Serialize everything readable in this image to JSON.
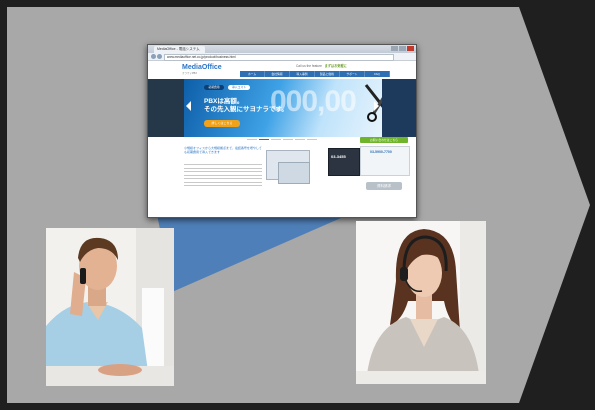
{
  "colors": {
    "background": "#1f1f1f",
    "chevron": "#a8a8a8",
    "funnel": "#4f7fb8",
    "accent_blue": "#2f6fb3",
    "accent_green": "#6fb52c",
    "accent_orange": "#f0a21b"
  },
  "browser": {
    "tab_title": "MediaOffice - 電話システム",
    "url": "www.mediaoffice.net.co.jp/product/business.html",
    "site": {
      "logo": "MediaOffice",
      "logo_sub": "クラウドPBX",
      "call_us": "Call us the feature",
      "call_us_badge": "まずはお気軽に",
      "nav": [
        "ホーム",
        "会社情報",
        "導入事例",
        "製品と価格",
        "サポート",
        "FAQ"
      ],
      "hero": {
        "pill_left": "初期費用",
        "pill_right": "導入コスト",
        "headline_1": "PBXは高額。",
        "headline_2": "その先入観にサヨナラです。",
        "button": "詳しくはこちら",
        "big_number": "000,00"
      },
      "contact_bar": "お問い合わせはこちら",
      "promo_text": "小規模オフィスから大規模拠点まで、電話番号を増やしても初期費用で導入できます",
      "phone_number": "03-3455",
      "side_number": "03-5900-7700",
      "side_button": "資料請求"
    }
  },
  "photos": {
    "left": "man-on-phone",
    "right": "woman-with-headset"
  }
}
